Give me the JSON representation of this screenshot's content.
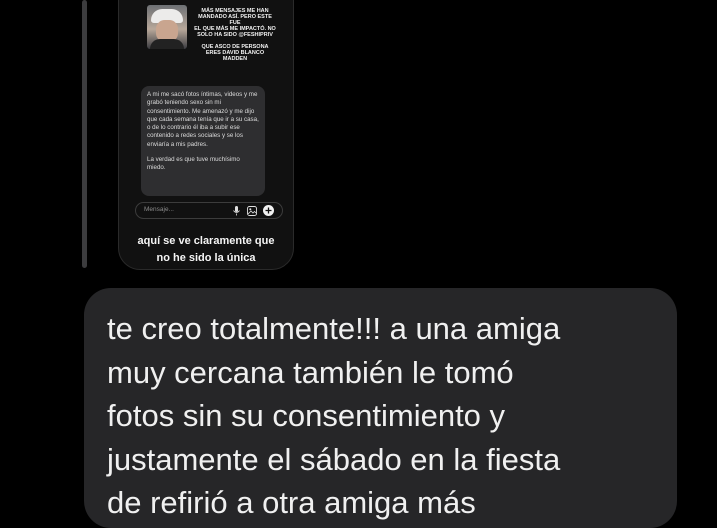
{
  "quoted_story": {
    "story_text": {
      "line1": "MÁS MENSAJES ME HAN",
      "line2": "MANDADO ASÍ. PERO ESTE FUE",
      "line3": "EL QUE MÁS ME IMPACTÓ. NO",
      "line4": "SOLO HA SIDO @FESHIPRIV",
      "line5": "QUE ASCO DE PERSONA",
      "line6": "ERES DAVID BLANCO",
      "line7": "MADDEN"
    },
    "message_paragraph1": "A mi me sacó fotos íntimas, videos y me grabó teniendo sexo sin mi consentimiento. Me amenazó y me dijo que cada semana tenía que ir a su casa, o de lo contrario él iba a subir ese contenido a redes sociales y se los enviaría a mis padres.",
    "message_paragraph2": "La verdad es que tuve muchísimo miedo.",
    "composer_placeholder": "Mensaje...",
    "caption_line1": "aquí se ve claramente que",
    "caption_line2": "no he sido la única"
  },
  "reply_message": {
    "text": "te creo totalmente!!! a una amiga\nmuy cercana también le tomó\nfotos sin su consentimiento y\njustamente el sábado en la fiesta\nde refirió a otra amiga más"
  },
  "colors": {
    "background": "#000000",
    "bubble": "#262628",
    "reply_bar": "#3c3c3e"
  },
  "icons": [
    "mic-icon",
    "gallery-icon",
    "plus-icon"
  ]
}
